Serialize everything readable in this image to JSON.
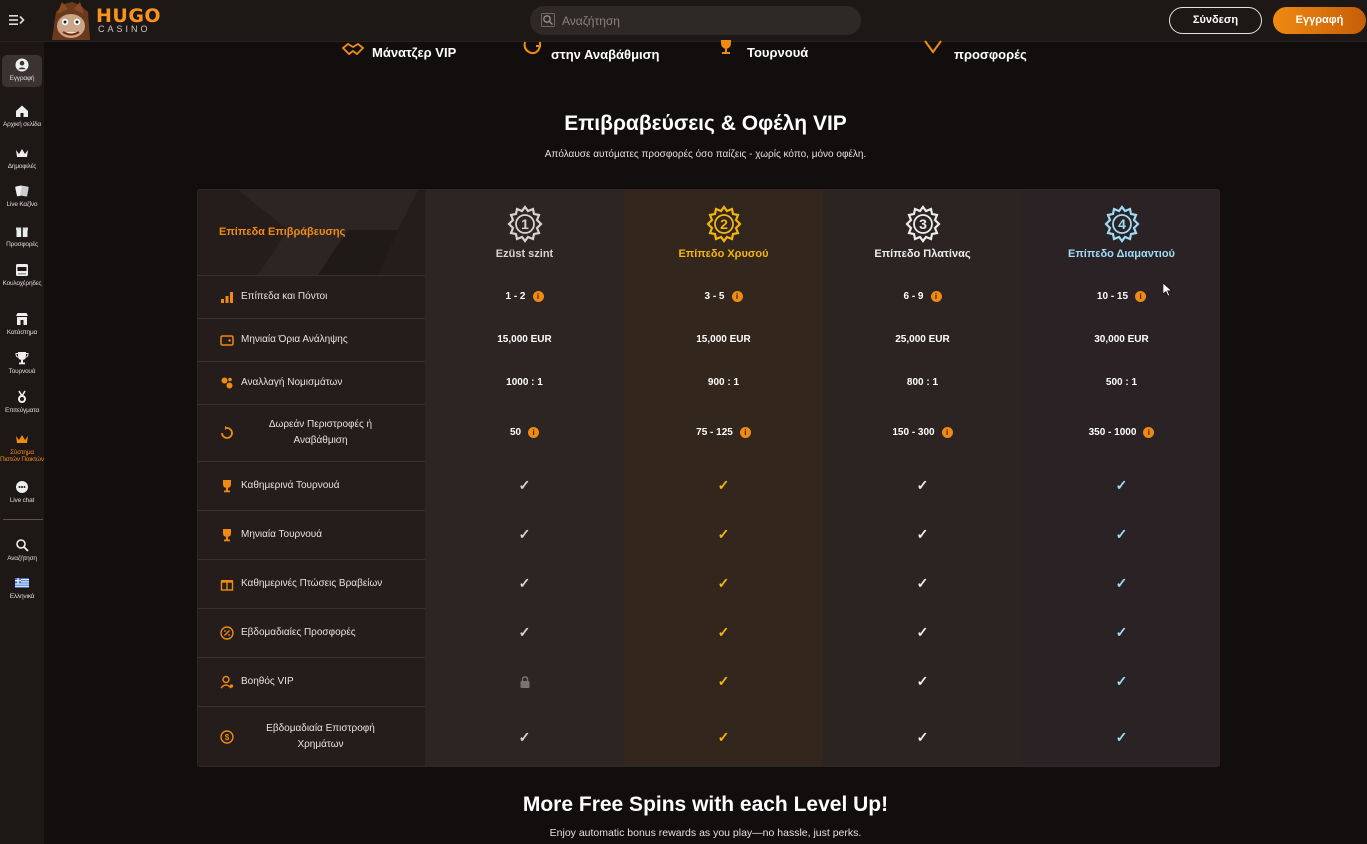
{
  "header": {
    "logo_text": "HUGO",
    "logo_subtext": "CASINO",
    "search_placeholder": "Αναζήτηση",
    "login_label": "Σύνδεση",
    "register_label": "Εγγραφή"
  },
  "sidebar": {
    "items": [
      {
        "label": "Εγγραφή",
        "icon": "user-icon"
      },
      {
        "label": "Αρχική σελίδα",
        "icon": "home-icon"
      },
      {
        "label": "Δημοφιλές",
        "icon": "crown-icon"
      },
      {
        "label": "Live Καζίνο",
        "icon": "cards-icon"
      },
      {
        "label": "Προσφορές",
        "icon": "gift-icon"
      },
      {
        "label": "Κουλοχέρηδες",
        "icon": "slot-machine-icon"
      },
      {
        "label": "Κατάστημα",
        "icon": "store-icon"
      },
      {
        "label": "Τουρνουά",
        "icon": "trophy-icon"
      },
      {
        "label": "Επιτεύγματα",
        "icon": "medal-icon"
      },
      {
        "label": "Σύστημα Πιστών Παικτών",
        "icon": "vip-crown-icon"
      },
      {
        "label": "Live chat",
        "icon": "chat-icon"
      },
      {
        "label": "Αναζήτηση",
        "icon": "search-icon"
      },
      {
        "label": "Ελληνικά",
        "icon": "greek-flag-icon"
      }
    ]
  },
  "perks_strip": [
    {
      "label": "Μάνατζερ VIP",
      "icon": "handshake-icon"
    },
    {
      "label": "στην Αναβάθμιση",
      "icon": "refresh-icon"
    },
    {
      "label": "Τουρνουά",
      "icon": "trophy-icon"
    },
    {
      "label": "προσφορές",
      "icon": "chevron-down-icon"
    }
  ],
  "section": {
    "title": "Επιβραβεύσεις & Οφέλη VIP",
    "subtitle": "Απόλαυσε αυτόματες προσφορές όσο παίζεις - χωρίς κόπο, μόνο οφέλη."
  },
  "table": {
    "header_label": "Επίπεδα Επιβράβευσης",
    "levels": [
      {
        "name": "Ezüst szint",
        "number": "1",
        "color": "#d8d3d0"
      },
      {
        "name": "Επίπεδο Χρυσού",
        "number": "2",
        "color": "#f5b50f"
      },
      {
        "name": "Επίπεδο Πλατίνας",
        "number": "3",
        "color": "#ececec"
      },
      {
        "name": "Επίπεδο Διαμαντιού",
        "number": "4",
        "color": "#9fdcf5"
      }
    ],
    "rows": [
      {
        "label": "Επίπεδα και Πόντοι",
        "icon": "bar-chart-icon",
        "values": [
          "1 - 2",
          "3 - 5",
          "6 - 9",
          "10 - 15"
        ],
        "info": true
      },
      {
        "label": "Μηνιαία Όρια Ανάληψης",
        "icon": "wallet-icon",
        "values": [
          "15,000 EUR",
          "15,000 EUR",
          "25,000 EUR",
          "30,000 EUR"
        ],
        "info": false
      },
      {
        "label": "Αναλλαγή Νομισμάτων",
        "icon": "coins-icon",
        "values": [
          "1000 : 1",
          "900 : 1",
          "800 : 1",
          "500 : 1"
        ],
        "info": false
      },
      {
        "label": "Δωρεάν Περιστροφές ή Αναβάθμιση",
        "icon": "spin-icon",
        "values": [
          "50",
          "75 - 125",
          "150 - 300",
          "350 - 1000"
        ],
        "info": true
      },
      {
        "label": "Καθημερινά Τουρνουά",
        "icon": "trophy-icon",
        "values": [
          "✓",
          "✓",
          "✓",
          "✓"
        ],
        "info": false
      },
      {
        "label": "Μηνιαία Τουρνουά",
        "icon": "trophy-icon",
        "values": [
          "✓",
          "✓",
          "✓",
          "✓"
        ],
        "info": false
      },
      {
        "label": "Καθημερινές Πτώσεις Βραβείων",
        "icon": "gift-icon",
        "values": [
          "✓",
          "✓",
          "✓",
          "✓"
        ],
        "info": false
      },
      {
        "label": "Εβδομαδιαίες Προσφορές",
        "icon": "percent-icon",
        "values": [
          "✓",
          "✓",
          "✓",
          "✓"
        ],
        "info": false
      },
      {
        "label": "Βοηθός VIP",
        "icon": "user-support-icon",
        "values": [
          "lock",
          "✓",
          "✓",
          "✓"
        ],
        "info": false
      },
      {
        "label": "Εβδομαδιαία Επιστροφή Χρημάτων",
        "icon": "cashback-icon",
        "values": [
          "✓",
          "✓",
          "✓",
          "✓"
        ],
        "info": false
      }
    ],
    "info_symbol": "i"
  },
  "footer_section": {
    "title": "More Free Spins with each Level Up!",
    "subtitle": "Enjoy automatic bonus rewards as you play—no hassle, just perks."
  },
  "colors": {
    "accent": "#f08a12",
    "background": "#110e0d"
  }
}
